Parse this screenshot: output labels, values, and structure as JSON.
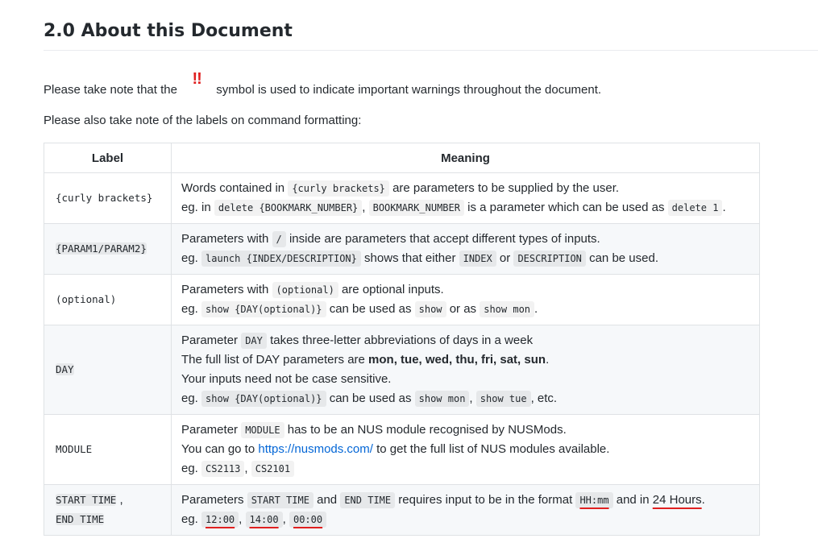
{
  "heading": "2.0 About this Document",
  "intro": {
    "before": "Please take note that the",
    "symbol": "!!",
    "after": "symbol is used to indicate important warnings throughout the document."
  },
  "labels_note": "Please also take note of the labels on command formatting:",
  "table": {
    "headers": [
      "Label",
      "Meaning"
    ],
    "rows": [
      {
        "label": "{curly brackets}",
        "l1": {
          "t1": "Words contained in",
          "c1": "{curly brackets}",
          "t2": "are parameters to be supplied by the user."
        },
        "l2": {
          "t1": "eg. in",
          "c1": "delete {BOOKMARK_NUMBER}",
          "t2": ",",
          "c2": "BOOKMARK_NUMBER",
          "t3": "is a parameter which can be used as",
          "c3": "delete 1",
          "t4": "."
        }
      },
      {
        "label": "{PARAM1/PARAM2}",
        "l1": {
          "t1": "Parameters with",
          "c1": "/",
          "t2": "inside are parameters that accept different types of inputs."
        },
        "l2": {
          "t1": "eg.",
          "c1": "launch {INDEX/DESCRIPTION}",
          "t2": "shows that either",
          "c2": "INDEX",
          "t3": "or",
          "c3": "DESCRIPTION",
          "t4": "can be used."
        }
      },
      {
        "label": "(optional)",
        "l1": {
          "t1": "Parameters with",
          "c1": "(optional)",
          "t2": "are optional inputs."
        },
        "l2": {
          "t1": "eg.",
          "c1": "show {DAY(optional)}",
          "t2": "can be used as",
          "c2": "show",
          "t3": "or as",
          "c3": "show mon",
          "t4": "."
        }
      },
      {
        "label": "DAY",
        "l1": {
          "t1": "Parameter",
          "c1": "DAY",
          "t2": "takes three-letter abbreviations of days in a week"
        },
        "l2": {
          "t1": "The full list of DAY parameters are",
          "b1": "mon, tue, wed, thu, fri, sat, sun",
          "t2": "."
        },
        "l3": {
          "t1": "Your inputs need not be case sensitive."
        },
        "l4": {
          "t1": "eg.",
          "c1": "show {DAY(optional)}",
          "t2": "can be used as",
          "c2": "show mon",
          "t3": ",",
          "c3": "show tue",
          "t4": ", etc."
        }
      },
      {
        "label": "MODULE",
        "l1": {
          "t1": "Parameter",
          "c1": "MODULE",
          "t2": "has to be an NUS module recognised by NUSMods."
        },
        "l2": {
          "t1": "You can go to",
          "link": "https://nusmods.com/",
          "t2": "to get the full list of NUS modules available."
        },
        "l3": {
          "t1": "eg.",
          "c1": "CS2113",
          "t2": ",",
          "c2": "CS2101"
        }
      },
      {
        "label": "START TIME",
        "label_sep": ",",
        "label2": "END TIME",
        "l1": {
          "t1": "Parameters",
          "c1": "START TIME",
          "t2": "and",
          "c2": "END TIME",
          "t3": "requires input to be in the format",
          "c3": "HH:mm",
          "t4": "and in",
          "t5": "24 Hours",
          "t6": "."
        },
        "l2": {
          "t1": "eg.",
          "c1": "12:00",
          "t2": ",",
          "c2": "14:00",
          "t3": ",",
          "c3": "00:00"
        }
      }
    ]
  },
  "colors": {
    "warning": "#e02020",
    "link": "#0366d6",
    "text": "#24292e",
    "alt_row": "#f6f8fa",
    "border": "#dfe2e5"
  }
}
